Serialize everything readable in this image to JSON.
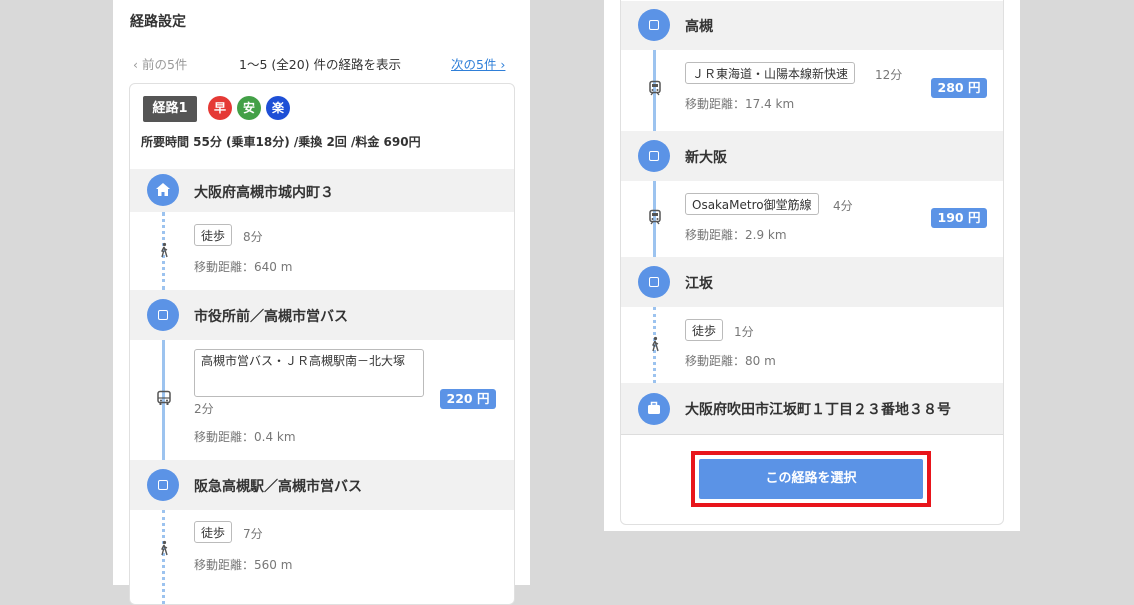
{
  "left": {
    "title": "経路設定",
    "pager": {
      "prev": "‹ 前の5件",
      "range": "1〜5 (全20) 件の経路を表示",
      "next": "次の5件 ›"
    },
    "route": {
      "badge": "経路1",
      "marks": [
        "早",
        "安",
        "楽"
      ],
      "summary": "所要時間 55分 (乗車18分) /乗換 2回 /料金 690円",
      "origin": "大阪府高槻市城内町３",
      "walk1": {
        "label": "徒歩",
        "time": "8分",
        "distance": "移動距離：640 m"
      },
      "stop1": "市役所前／高槻市営バス",
      "bus": {
        "line": "高槻市営バス・ＪＲ高槻駅南－北大塚",
        "time": "2分",
        "distance": "移動距離：0.4 km",
        "fare": "220 円"
      },
      "stop2": "阪急高槻駅／高槻市営バス",
      "walk2": {
        "label": "徒歩",
        "time": "7分",
        "distance": "移動距離：560 m"
      }
    }
  },
  "right": {
    "stop3": "高槻",
    "jr": {
      "line": "ＪＲ東海道・山陽本線新快速",
      "time": "12分",
      "distance": "移動距離：17.4 km",
      "fare": "280 円"
    },
    "stop4": "新大阪",
    "metro": {
      "line": "OsakaMetro御堂筋線",
      "time": "4分",
      "distance": "移動距離：2.9 km",
      "fare": "190 円"
    },
    "stop5": "江坂",
    "walk3": {
      "label": "徒歩",
      "time": "1分",
      "distance": "移動距離：80 m"
    },
    "destination": "大阪府吹田市江坂町１丁目２３番地３８号",
    "select_button": "この経路を選択"
  }
}
